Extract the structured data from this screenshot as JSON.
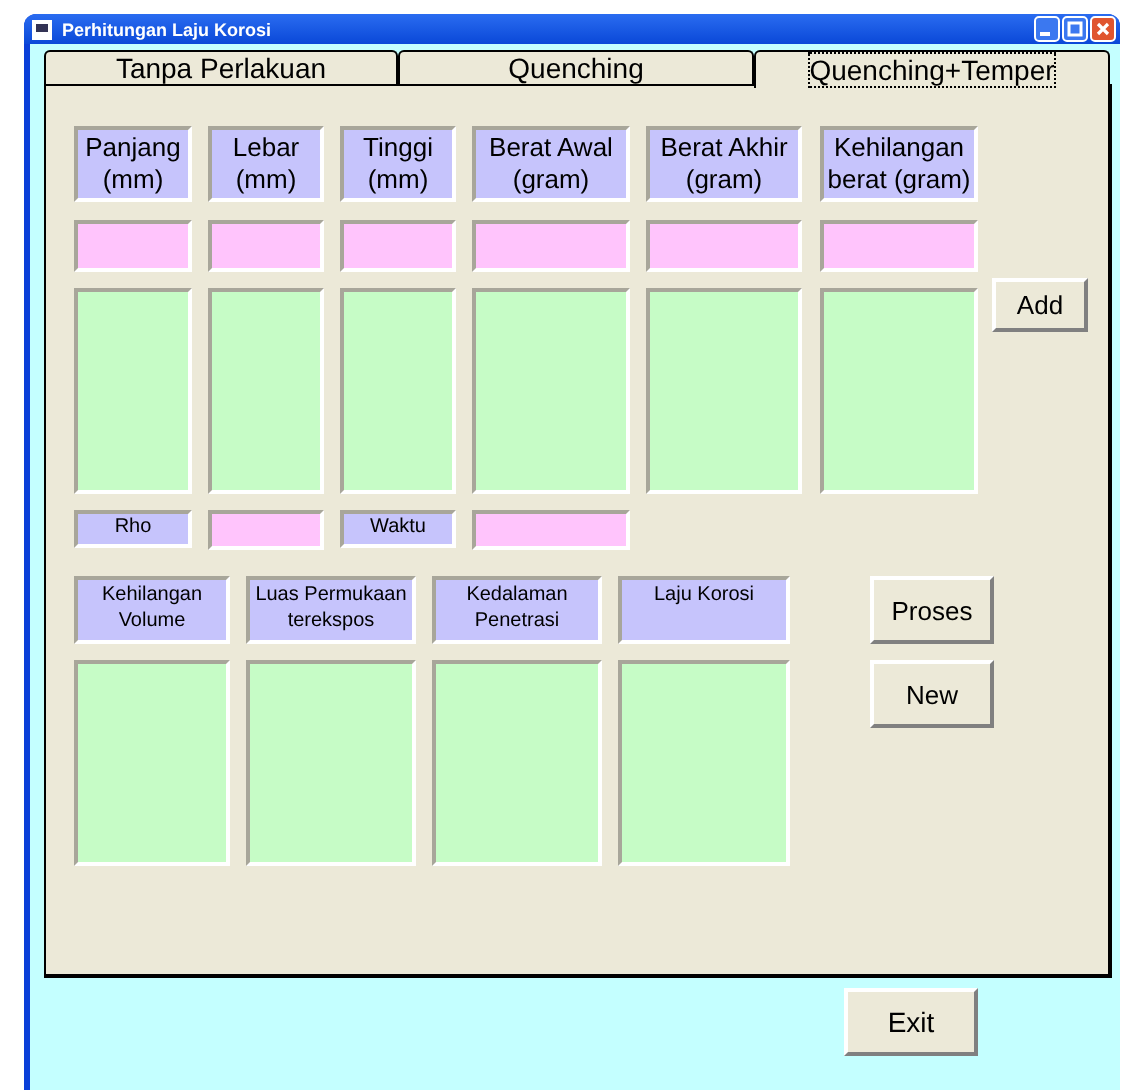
{
  "window": {
    "title": "Perhitungan Laju Korosi"
  },
  "tabs": [
    {
      "label": "Tanpa Perlakuan",
      "selected": false
    },
    {
      "label": "Quenching",
      "selected": false
    },
    {
      "label": "Quenching+Temper",
      "selected": true
    }
  ],
  "measurements": [
    "Panjang\n(mm)",
    "Lebar\n(mm)",
    "Tinggi\n(mm)",
    "Berat Awal\n(gram)",
    "Berat Akhir\n(gram)",
    "Kehilangan\nberat (gram)"
  ],
  "parameters": [
    "Rho",
    "Waktu"
  ],
  "results": [
    "Kehilangan\nVolume",
    "Luas Permukaan\nterekspos",
    "Kedalaman\nPenetrasi",
    "Laju Korosi"
  ],
  "buttons": {
    "add": "Add",
    "process": "Proses",
    "new": "New",
    "exit": "Exit"
  }
}
